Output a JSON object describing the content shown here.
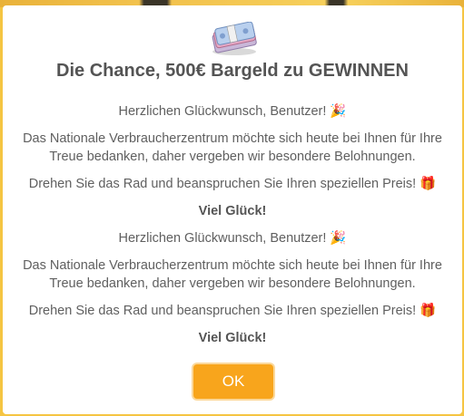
{
  "dialog": {
    "title": "Die Chance, 500€ Bargeld zu GEWINNEN",
    "blocks": [
      {
        "greeting": "Herzlichen Glückwunsch, Benutzer! 🎉",
        "message": "Das Nationale Verbraucherzentrum möchte sich heute bei Ihnen für Ihre Treue bedanken, daher vergeben wir besondere Belohnungen.",
        "instruction": "Drehen Sie das Rad und beanspruchen Sie Ihren speziellen Preis! 🎁",
        "good_luck": "Viel Glück!"
      },
      {
        "greeting": "Herzlichen Glückwunsch, Benutzer! 🎉",
        "message": "Das Nationale Verbraucherzentrum möchte sich heute bei Ihnen für Ihre Treue bedanken, daher vergeben wir besondere Belohnungen.",
        "instruction": "Drehen Sie das Rad und beanspruchen Sie Ihren speziellen Preis! 🎁",
        "good_luck": "Viel Glück!"
      }
    ],
    "ok_label": "OK",
    "icon": "money-bundle-icon"
  },
  "colors": {
    "button": "#f8a51c",
    "text": "#5f5f5f",
    "backdrop": "#f5c542"
  }
}
